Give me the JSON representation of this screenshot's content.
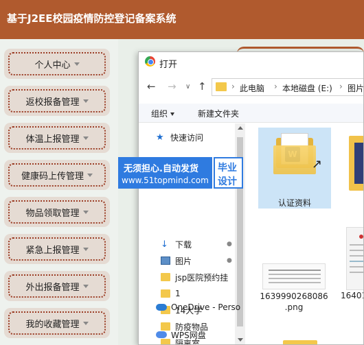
{
  "app": {
    "title": "基于J2EE校园疫情防控登记备案系统"
  },
  "sidebar": {
    "items": [
      {
        "label": "个人中心"
      },
      {
        "label": "返校报备管理"
      },
      {
        "label": "体温上报管理"
      },
      {
        "label": "健康码上传管理"
      },
      {
        "label": "物品领取管理"
      },
      {
        "label": "紧急上报管理"
      },
      {
        "label": "外出报备管理"
      },
      {
        "label": "我的收藏管理"
      }
    ]
  },
  "dialog": {
    "title": "打开",
    "address": [
      "此电脑",
      "本地磁盘 (E:)",
      "图片"
    ],
    "toolbar": {
      "organize": "组织",
      "new_folder": "新建文件夹"
    },
    "nav_items": [
      {
        "label": "快速访问",
        "icon": "star-icon"
      },
      {
        "label": "下载",
        "icon": "download-icon"
      },
      {
        "label": "图片",
        "icon": "picture-icon"
      },
      {
        "label": "jsp医院预约挂",
        "icon": "folder-icon"
      },
      {
        "label": "1",
        "icon": "folder-icon"
      },
      {
        "label": "14大学",
        "icon": "folder-icon"
      },
      {
        "label": "防疫物品",
        "icon": "folder-icon"
      },
      {
        "label": "隔离室",
        "icon": "folder-icon"
      },
      {
        "label": "OneDrive - Perso",
        "icon": "onedrive-icon"
      },
      {
        "label": "WPS网盘",
        "icon": "wps-cloud-icon"
      }
    ],
    "files": [
      {
        "label": "认证资料",
        "type": "folder"
      },
      {
        "label": "1639990268086\n.png",
        "type": "image"
      },
      {
        "label": "16401",
        "type": "image"
      }
    ]
  },
  "watermark": {
    "line1": "无须担心.自动发货",
    "line2": "www.51topmind.com",
    "tag1": "毕业",
    "tag2": "设计"
  },
  "colors": {
    "header": "#b05a2e",
    "menu_border": "#9b3d25",
    "watermark_blue": "#2f7be0"
  }
}
